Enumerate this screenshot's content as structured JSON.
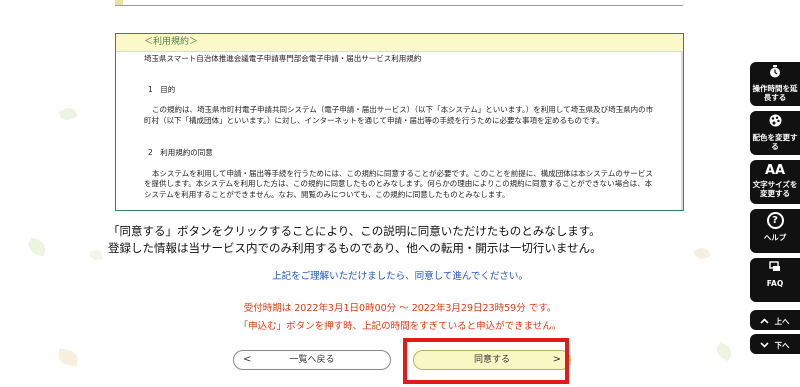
{
  "terms": {
    "header": "＜利用規約＞",
    "title": "埼玉県スマート自治体推進会議電子申請専門部会電子申請・届出サービス利用規約",
    "section1_heading": "1　目的",
    "section1_text": "この規約は、埼玉県市町村電子申請共同システム（電子申請・届出サービス）（以下「本システム」といいます。）を利用して埼玉県及び埼玉県内の市町村（以下「構成団体」といいます。）に対し、インターネットを通じて申請・届出等の手続を行うために必要な事項を定めるものです。",
    "section2_heading": "2　利用規約の同意",
    "section2_text": "本システムを利用して申請・届出等手続を行うためには、この規約に同意することが必要です。このことを前提に、構成団体は本システムのサービスを提供します。本システムを利用した方は、この規約に同意したものとみなします。何らかの理由によりこの規約に同意することができない場合は、本システムを利用することができません。なお、閲覧のみについても、この規約に同意したものとみなします。"
  },
  "consent": {
    "line1": "「同意する」ボタンをクリックすることにより、この説明に同意いただけたものとみなします。",
    "line2": "登録した情報は当サービス内でのみ利用するものであり、他への転用・開示は一切行いません。"
  },
  "notice": {
    "blue": "上記をご理解いただけましたら、同意して進んでください。",
    "period": "受付時期は 2022年3月1日0時00分 ～ 2022年3月29日23時59分 です。",
    "warning": "「申込む」ボタンを押す時、上記の時間をすぎていると申込ができません。"
  },
  "buttons": {
    "back_label": "一覧へ戻る",
    "agree_label": "同意する",
    "back_chevron": "<",
    "agree_chevron": ">"
  },
  "sidebar": {
    "extend_time": "操作時間を延長する",
    "color": "配色を変更する",
    "font_size": "文字サイズを変更する",
    "help": "ヘルプ",
    "faq": "FAQ",
    "up": "上へ",
    "down": "下へ",
    "font_icon": "AA",
    "help_icon": "?"
  },
  "colors": {
    "highlight": "#e11a1a",
    "terms_border": "#2f7f7c",
    "agree_bg": "#f8f8c4",
    "blue_text": "#1f56b8",
    "red_text": "#e03a10"
  }
}
